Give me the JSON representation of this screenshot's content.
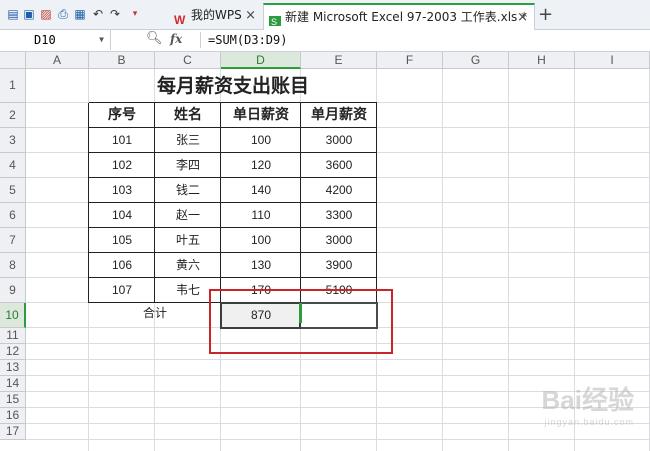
{
  "titlebar": {
    "tabs": [
      {
        "label": "我的WPS"
      },
      {
        "label": "新建 Microsoft Excel 97-2003 工作表.xls *"
      }
    ],
    "new_tab": "+",
    "close_glyph": "×"
  },
  "formula_bar": {
    "name_box": "D10",
    "fx": "fx",
    "formula": "=SUM(D3:D9)"
  },
  "columns": [
    "A",
    "B",
    "C",
    "D",
    "E",
    "F",
    "G",
    "H",
    "I"
  ],
  "rows": [
    "1",
    "2",
    "3",
    "4",
    "5",
    "6",
    "7",
    "8",
    "9",
    "10",
    "11",
    "12",
    "13",
    "14",
    "15",
    "16",
    "17"
  ],
  "sheet": {
    "title": "每月薪资支出账目",
    "headers": [
      "序号",
      "姓名",
      "单日薪资",
      "单月薪资"
    ],
    "data": [
      [
        "101",
        "张三",
        "100",
        "3000"
      ],
      [
        "102",
        "李四",
        "120",
        "3600"
      ],
      [
        "103",
        "钱二",
        "140",
        "4200"
      ],
      [
        "104",
        "赵一",
        "110",
        "3300"
      ],
      [
        "105",
        "叶五",
        "100",
        "3000"
      ],
      [
        "106",
        "黄六",
        "130",
        "3900"
      ],
      [
        "107",
        "韦七",
        "170",
        "5100"
      ]
    ],
    "total_label": "合计",
    "total_value": "870"
  },
  "watermark": {
    "text": "Bai经验",
    "sub": "jingyan.baidu.com"
  },
  "colors": {
    "selection": "#2e9b3e",
    "annotation": "#c8252b"
  }
}
